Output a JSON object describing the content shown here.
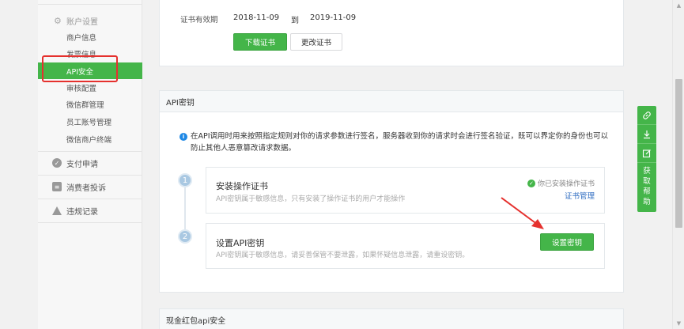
{
  "sidebar": {
    "section_title": "账户设置",
    "items": [
      {
        "label": "商户信息"
      },
      {
        "label": "发票信息"
      },
      {
        "label": "API安全"
      },
      {
        "label": "审核配置"
      },
      {
        "label": "微信群管理"
      },
      {
        "label": "员工账号管理"
      },
      {
        "label": "微信商户终端"
      }
    ],
    "groups": [
      {
        "label": "支付申请"
      },
      {
        "label": "消费者投诉"
      },
      {
        "label": "违规记录"
      }
    ]
  },
  "cert": {
    "validity_label": "证书有效期",
    "start_date": "2018-11-09",
    "separator": "到",
    "end_date": "2019-11-09",
    "download_label": "下载证书",
    "change_label": "更改证书"
  },
  "api_key": {
    "title": "API密钥",
    "notice": "在API调用时用来按照指定规则对你的请求参数进行签名，服务器收到你的请求时会进行签名验证，既可以界定你的身份也可以防止其他人恶意篡改请求数据。",
    "steps": [
      {
        "num": "1",
        "title": "安装操作证书",
        "desc": "API密钥属于敏感信息，只有安装了操作证书的用户才能操作",
        "status": "你已安装操作证书",
        "link": "证书管理"
      },
      {
        "num": "2",
        "title": "设置API密钥",
        "desc": "API密钥属于敏感信息，请妥善保管不要泄露，如果怀疑信息泄露，请重设密钥。",
        "button": "设置密钥"
      }
    ]
  },
  "redpack": {
    "title": "现金红包api安全"
  },
  "float_bar": {
    "help_chars": [
      "获",
      "取",
      "帮",
      "助"
    ]
  },
  "colors": {
    "accent": "#44b549",
    "highlight": "#e5312e",
    "link": "#2e6cc1"
  }
}
